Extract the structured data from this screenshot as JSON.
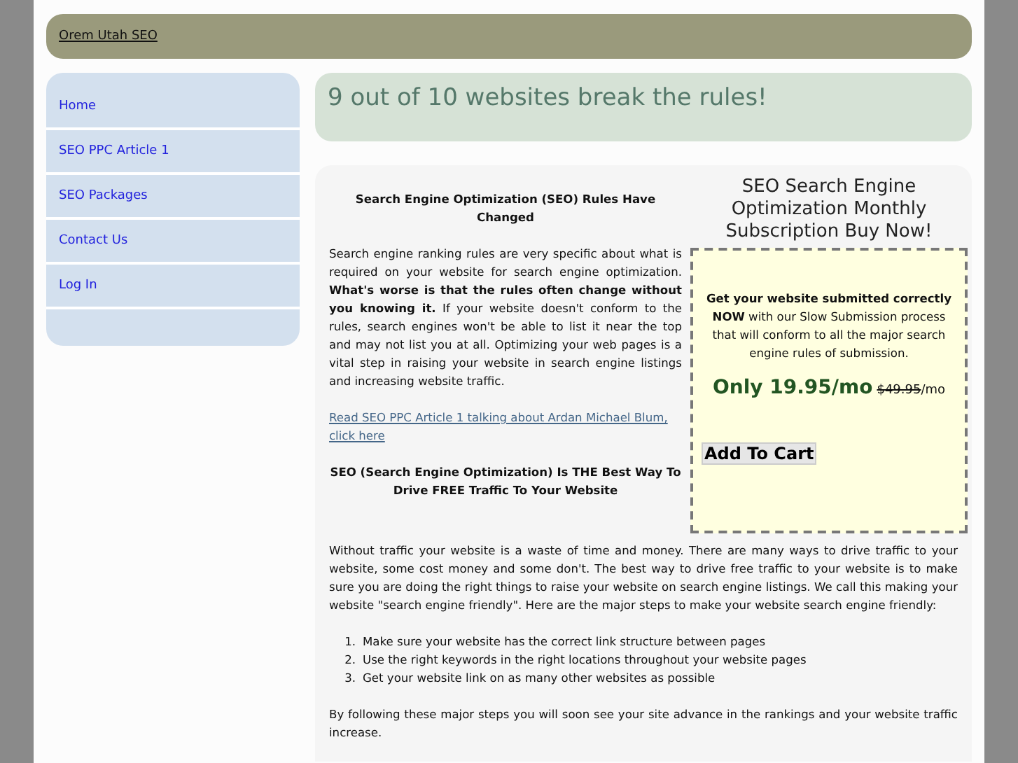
{
  "header": {
    "site_link": "Orem Utah SEO"
  },
  "sidebar": {
    "items": [
      {
        "label": "Home"
      },
      {
        "label": "SEO PPC Article 1"
      },
      {
        "label": "SEO Packages"
      },
      {
        "label": "Contact Us"
      },
      {
        "label": "Log In"
      }
    ]
  },
  "page_title": "9 out of 10 websites break the rules!",
  "ad": {
    "title": "SEO Search Engine Optimization Monthly Subscription Buy Now!",
    "text": "**Get your website submitted correctly NOW** with our Slow Submission process that will conform to all the major search engine rules of submission.",
    "price": "Only 19.95/mo",
    "old_price": "$49.95",
    "old_price_suffix": "/mo",
    "button": "Add To Cart"
  },
  "article": [
    {
      "kind": "heading",
      "text": "Search Engine Optimization (SEO) Rules Have Changed"
    },
    {
      "kind": "paragraph",
      "text": "Search engine ranking rules are very specific about what is required on your website for search engine optimization. **What's worse is that the rules often change without you knowing it.** If your website doesn't conform to the rules, search engines won't be able to list it near the top and may not list you at all. Optimizing your web pages is a vital step in raising your website in search engine listings and increasing website traffic."
    },
    {
      "kind": "link",
      "text": "Read SEO PPC Article 1 talking about Ardan Michael Blum, click here"
    },
    {
      "kind": "heading",
      "text": "SEO (Search Engine Optimization) Is THE Best Way To Drive FREE Traffic To Your Website"
    },
    {
      "kind": "paragraph",
      "text": "Without traffic your website is a waste of time and money. There are many ways to drive traffic to your website, some cost money and some don't. The best way to drive free traffic to your website is to make sure you are doing the right things to raise your website on search engine listings. We call this making your website \"search engine friendly\". Here are the major steps to make your website search engine friendly:"
    },
    {
      "kind": "list",
      "items": [
        {
          "marker": "1.",
          "text": "Make sure your website has the correct link structure between pages"
        },
        {
          "marker": "2.",
          "text": "Use the right keywords in the right locations throughout your website pages"
        },
        {
          "marker": "3.",
          "text": "Get your website link on as many other websites as possible"
        }
      ]
    },
    {
      "kind": "paragraph",
      "text": "By following these major steps you will soon see your site advance in the rankings and your website traffic increase."
    }
  ]
}
